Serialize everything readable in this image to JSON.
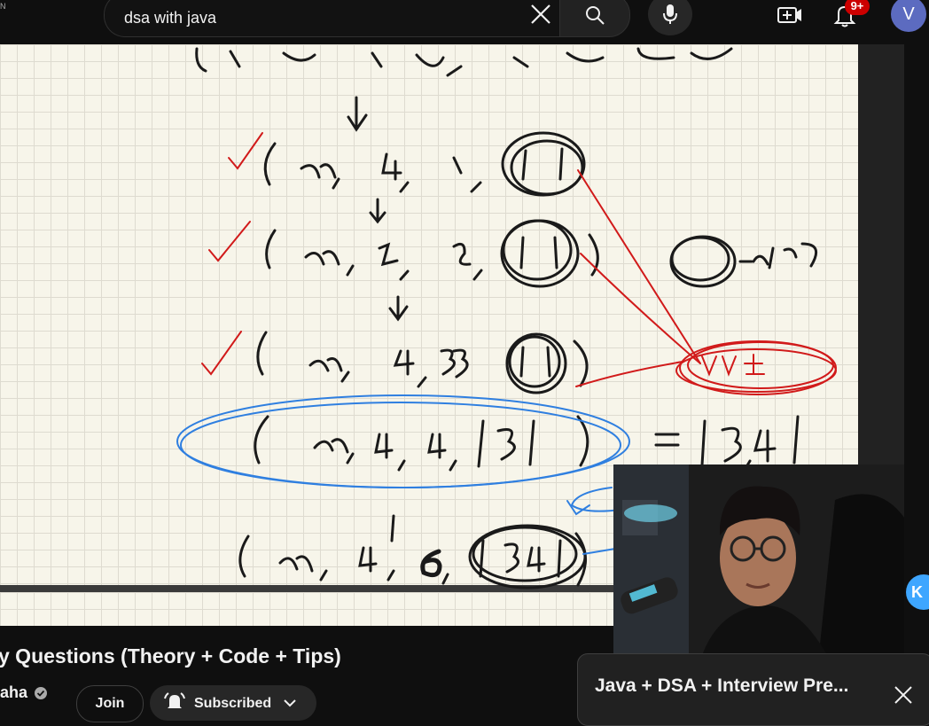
{
  "header": {
    "corner_letter": "N",
    "search": {
      "value": "dsa with java",
      "placeholder": "Search"
    },
    "notifications": {
      "badge": "9+"
    },
    "avatar": {
      "initial": "V"
    }
  },
  "icons": [
    "clear-icon",
    "search-icon",
    "mic-icon",
    "create-video-icon",
    "bell-icon",
    "verified-icon",
    "chevron-down-icon",
    "close-icon"
  ],
  "player": {
    "skip_label": "K"
  },
  "video": {
    "title": "y Questions (Theory + Code + Tips)",
    "channel": "aha",
    "join_label": "Join",
    "subscribed_label": "Subscribed"
  },
  "playlist": {
    "title": "Java + DSA + Interview Pre..."
  },
  "colors": {
    "ink_black": "#1a1a1a",
    "ink_red": "#d11a1a",
    "ink_blue": "#2f7fe0",
    "badge_red": "#cc0000",
    "avatar": "#5c6bc0"
  }
}
